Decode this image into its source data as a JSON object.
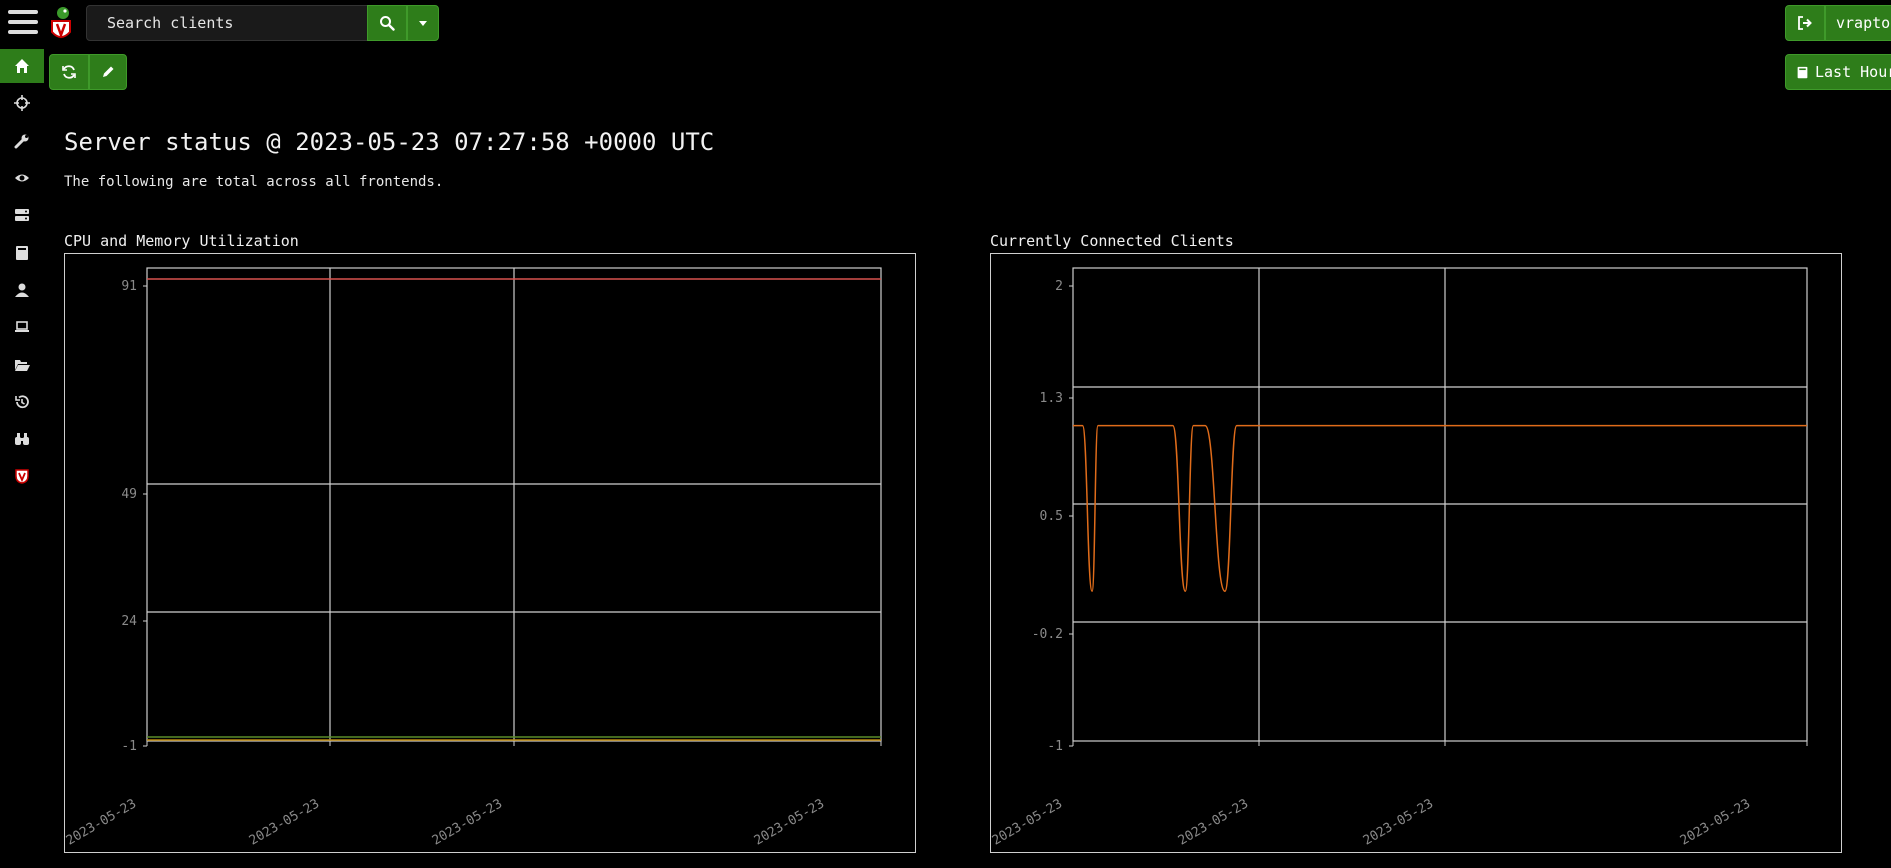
{
  "search": {
    "placeholder": "Search clients"
  },
  "header": {
    "user_label": "vraptor",
    "time_range_label": "Last Hour"
  },
  "nav": {
    "items": [
      {
        "name": "home",
        "icon": "home-icon",
        "active": true
      },
      {
        "name": "hunts",
        "icon": "crosshair-icon"
      },
      {
        "name": "artifacts",
        "icon": "wrench-icon"
      },
      {
        "name": "events",
        "icon": "eye-icon"
      },
      {
        "name": "server",
        "icon": "server-icon"
      },
      {
        "name": "notebooks",
        "icon": "book-icon"
      },
      {
        "name": "users",
        "icon": "user-icon"
      },
      {
        "name": "clients",
        "icon": "laptop-icon"
      },
      {
        "name": "files",
        "icon": "folder-open-icon"
      },
      {
        "name": "history",
        "icon": "history-icon"
      },
      {
        "name": "search",
        "icon": "binoculars-icon"
      },
      {
        "name": "velociraptor",
        "icon": "velociraptor-shield-icon"
      }
    ]
  },
  "page": {
    "title": "Server status @ 2023-05-23 07:27:58 +0000 UTC",
    "subtitle": "The following are total across all frontends."
  },
  "colors": {
    "accent": "#2e7d1a",
    "series_orange": "#e06c1a",
    "series_red": "#d9534f",
    "series_green": "#5a8c2a"
  },
  "chart_data": [
    {
      "type": "line",
      "title": "CPU and Memory Utilization",
      "x_tick_labels": [
        "2023-05-23",
        "2023-05-23",
        "2023-05-23",
        "2023-05-23"
      ],
      "y_tick_labels": [
        "91",
        "49",
        "24",
        "-1"
      ],
      "ylim": [
        -1,
        93
      ],
      "grid": true,
      "series": [
        {
          "color": "#d9534f",
          "x": [
            0,
            100
          ],
          "y": [
            92,
            92
          ]
        },
        {
          "color": "#5a8c2a",
          "x": [
            0,
            100
          ],
          "y": [
            0.8,
            0.8
          ]
        },
        {
          "color": "#b8860b",
          "x": [
            0,
            100
          ],
          "y": [
            0.2,
            0.2
          ]
        }
      ]
    },
    {
      "type": "line",
      "title": "Currently Connected Clients",
      "x_tick_labels": [
        "2023-05-23",
        "2023-05-23",
        "2023-05-23",
        "2023-05-23"
      ],
      "y_tick_labels": [
        "2",
        "1.3",
        "0.5",
        "-0.2",
        "-1"
      ],
      "ylim": [
        -1,
        2.1
      ],
      "grid": true,
      "series": [
        {
          "color": "#e06c1a",
          "x": [
            0,
            1.3,
            2.6,
            3.4,
            13.6,
            15.3,
            16.4,
            18.0,
            20.7,
            22.3,
            23.4,
            24.8,
            100
          ],
          "y": [
            1,
            1,
            -0.05,
            1,
            1,
            -0.05,
            1,
            1,
            -0.05,
            1,
            1,
            1,
            1
          ]
        }
      ]
    }
  ]
}
